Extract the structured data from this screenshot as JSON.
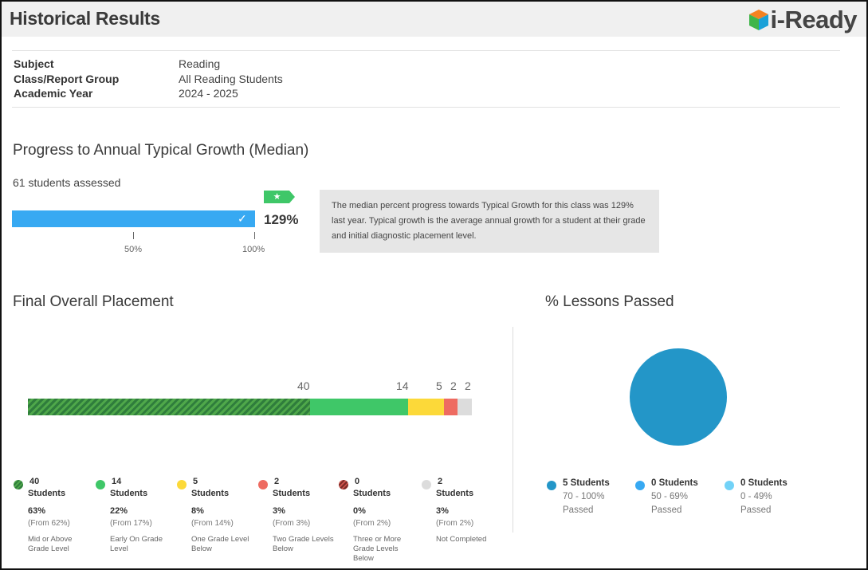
{
  "header": {
    "title": "Historical Results",
    "logo_text": "i-Ready"
  },
  "meta": [
    {
      "label": "Subject",
      "value": "Reading"
    },
    {
      "label": "Class/Report Group",
      "value": "All Reading Students"
    },
    {
      "label": "Academic Year",
      "value": "2024 - 2025"
    }
  ],
  "progress": {
    "title": "Progress to Annual Typical Growth (Median)",
    "assessed": "61 students assessed",
    "percent_label": "129%",
    "value_percent": 129,
    "flag_icon": "star-icon",
    "check_icon": "check-icon",
    "ticks": [
      "50%",
      "100%"
    ],
    "tooltip": "The median percent progress towards Typical Growth for this class was 129% last year. Typical growth is the average annual growth for a student at their grade and initial diagnostic placement level.",
    "bar_color": "#37a9f2",
    "flag_color": "#3fc768"
  },
  "placement": {
    "title": "Final Overall Placement",
    "bar_labels": [
      "40",
      "14",
      "5",
      "2",
      "2"
    ],
    "legend": [
      {
        "count": "40",
        "unit": "Students",
        "pct": "63%",
        "from": "(From 62%)",
        "desc": "Mid or Above Grade Level",
        "color": "#3fc768"
      },
      {
        "count": "14",
        "unit": "Students",
        "pct": "22%",
        "from": "(From 17%)",
        "desc": "Early On Grade Level",
        "color": "#3fc768"
      },
      {
        "count": "5",
        "unit": "Students",
        "pct": "8%",
        "from": "(From 14%)",
        "desc": "One Grade Level Below",
        "color": "#fcd939"
      },
      {
        "count": "2",
        "unit": "Students",
        "pct": "3%",
        "from": "(From 3%)",
        "desc": "Two Grade Levels Below",
        "color": "#ee6b61"
      },
      {
        "count": "0",
        "unit": "Students",
        "pct": "0%",
        "from": "(From 2%)",
        "desc": "Three or More Grade Levels Below",
        "color": "#c9514a"
      },
      {
        "count": "2",
        "unit": "Students",
        "pct": "3%",
        "from": "(From 2%)",
        "desc": "Not Completed",
        "color": "#dcdcdc"
      }
    ]
  },
  "lessons": {
    "title": "% Lessons Passed",
    "legend": [
      {
        "count": "5 Students",
        "range": "70 - 100%",
        "status": "Passed",
        "color": "#2396c8"
      },
      {
        "count": "0 Students",
        "range": "50 - 69%",
        "status": "Passed",
        "color": "#37a9f2"
      },
      {
        "count": "0 Students",
        "range": "0 - 49%",
        "status": "Passed",
        "color": "#72d2f7"
      }
    ]
  },
  "chart_data": [
    {
      "type": "bar",
      "title": "Final Overall Placement",
      "categories": [
        "Mid or Above Grade Level",
        "Early On Grade Level",
        "One Grade Level Below",
        "Two Grade Levels Below",
        "Three or More Grade Levels Below",
        "Not Completed"
      ],
      "values": [
        40,
        14,
        5,
        2,
        0,
        2
      ]
    },
    {
      "type": "pie",
      "title": "% Lessons Passed",
      "categories": [
        "70 - 100%",
        "50 - 69%",
        "0 - 49%"
      ],
      "values": [
        5,
        0,
        0
      ]
    }
  ]
}
